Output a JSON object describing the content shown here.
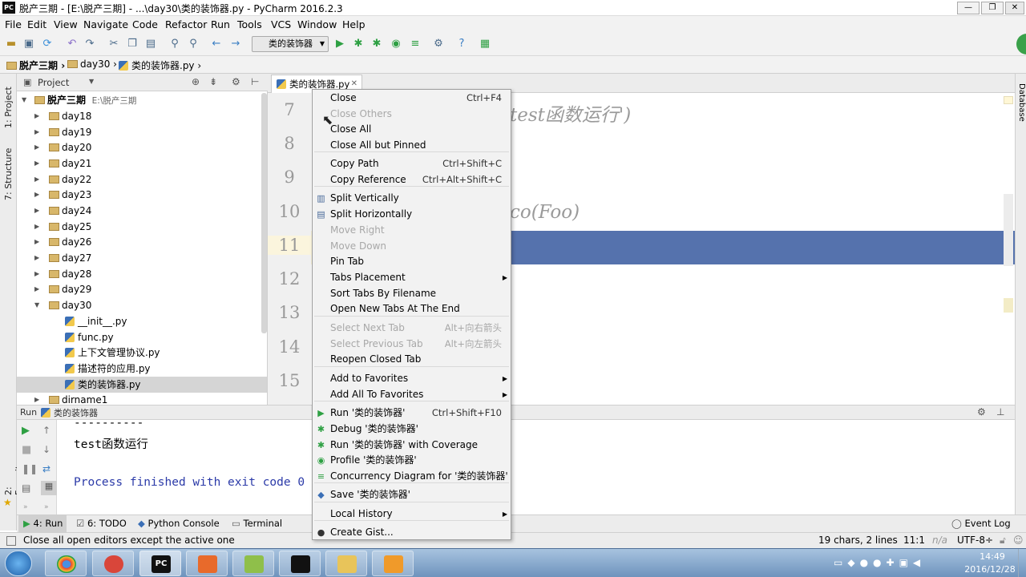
{
  "window": {
    "app_icon": "PC",
    "title": "脱产三期 - [E:\\脱产三期] - ...\\day30\\类的装饰器.py - PyCharm 2016.2.3",
    "minimize": "—",
    "maximize": "❐",
    "close": "✕"
  },
  "menu": [
    "File",
    "Edit",
    "View",
    "Navigate",
    "Code",
    "Refactor",
    "Run",
    "Tools",
    "VCS",
    "Window",
    "Help"
  ],
  "toolbar": {
    "run_config": "类的装饰器"
  },
  "breadcrumb": [
    "脱产三期",
    "day30",
    "类的装饰器.py"
  ],
  "left_strip": {
    "project": "1: Project",
    "structure": "7: Structure",
    "favorites": "2: Favorites"
  },
  "right_strip": {
    "database": "Database"
  },
  "project_panel": {
    "header": "Project",
    "root": {
      "name": "脱产三期",
      "path": "E:\\脱产三期"
    },
    "folders": [
      "day18",
      "day19",
      "day20",
      "day21",
      "day22",
      "day23",
      "day24",
      "day25",
      "day26",
      "day27",
      "day28",
      "day29",
      "day30"
    ],
    "files": [
      "__init__.py",
      "func.py",
      "上下文管理协议.py",
      "描述符的应用.py",
      "类的装饰器.py"
    ],
    "selected_file": "类的装饰器.py",
    "partial_row": "dirname1"
  },
  "editor": {
    "tab": "类的装饰器.py",
    "line_numbers": [
      "7",
      "8",
      "9",
      "10",
      "11",
      "12",
      "13",
      "14",
      "15"
    ],
    "code_fragments": [
      "test函数运行')",
      "co(Foo)"
    ]
  },
  "run_panel": {
    "header_label": "Run",
    "config": "类的装饰器",
    "console": [
      "----------",
      "test函数运行",
      "Process finished with exit code 0"
    ]
  },
  "bottom_tabs": [
    "4: Run",
    "6: TODO",
    "Python Console",
    "Terminal"
  ],
  "event_log": "Event Log",
  "status": {
    "message": "Close all open editors except the active one",
    "chars": "19 chars, 2 lines",
    "position": "11:1",
    "na": "n/a",
    "encoding": "UTF-8÷"
  },
  "clock": {
    "time": "14:49",
    "date": "2016/12/28"
  },
  "context_menu": [
    {
      "label": "Close",
      "shortcut": "Ctrl+F4"
    },
    {
      "label": "Close Others",
      "disabled": true
    },
    {
      "label": "Close All"
    },
    {
      "label": "Close All but Pinned"
    },
    {
      "label": "Copy Path",
      "shortcut": "Ctrl+Shift+C"
    },
    {
      "label": "Copy Reference",
      "shortcut": "Ctrl+Alt+Shift+C"
    },
    {
      "label": "Split Vertically",
      "icon": "split-vertical-icon"
    },
    {
      "label": "Split Horizontally",
      "icon": "split-horizontal-icon"
    },
    {
      "label": "Move Right",
      "disabled": true
    },
    {
      "label": "Move Down",
      "disabled": true
    },
    {
      "label": "Pin Tab"
    },
    {
      "label": "Tabs Placement",
      "submenu": true
    },
    {
      "label": "Sort Tabs By Filename"
    },
    {
      "label": "Open New Tabs At The End"
    },
    {
      "label": "Select Next Tab",
      "shortcut": "Alt+向右箭头",
      "disabled": true
    },
    {
      "label": "Select Previous Tab",
      "shortcut": "Alt+向左箭头",
      "disabled": true
    },
    {
      "label": "Reopen Closed Tab"
    },
    {
      "label": "Add to Favorites",
      "submenu": true
    },
    {
      "label": "Add All To Favorites",
      "submenu": true
    },
    {
      "label": "Run '类的装饰器'",
      "shortcut": "Ctrl+Shift+F10",
      "icon": "run-icon"
    },
    {
      "label": "Debug '类的装饰器'",
      "icon": "debug-icon"
    },
    {
      "label": "Run '类的装饰器' with Coverage",
      "icon": "coverage-icon"
    },
    {
      "label": "Profile '类的装饰器'",
      "icon": "profile-icon"
    },
    {
      "label": "Concurrency Diagram for  '类的装饰器'",
      "icon": "concurrency-icon"
    },
    {
      "label": "Save '类的装饰器'",
      "icon": "python-icon"
    },
    {
      "label": "Local History",
      "submenu": true
    },
    {
      "label": "Create Gist...",
      "icon": "github-icon"
    }
  ]
}
